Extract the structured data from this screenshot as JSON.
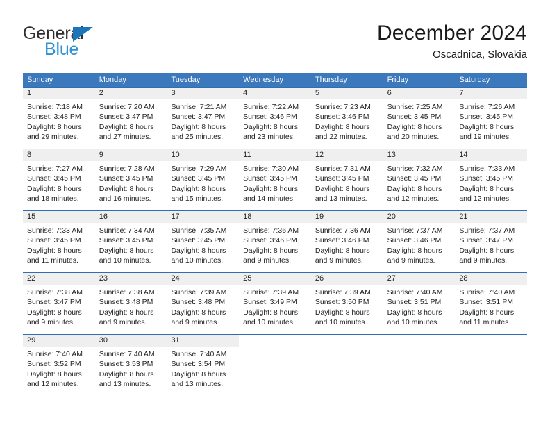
{
  "brand": {
    "name_top": "General",
    "name_bottom": "Blue",
    "triangle_color": "#1b75bb",
    "blue_text_color": "#2f92d6"
  },
  "header": {
    "title": "December 2024",
    "subtitle": "Oscadnica, Slovakia"
  },
  "theme": {
    "header_row_bg": "#3c78bc",
    "header_row_text": "#ffffff",
    "week_divider": "#2e6eb4",
    "day_number_bg": "#efefef",
    "body_text": "#231f20"
  },
  "weekdays": [
    "Sunday",
    "Monday",
    "Tuesday",
    "Wednesday",
    "Thursday",
    "Friday",
    "Saturday"
  ],
  "weeks": [
    [
      {
        "day": "1",
        "sunrise": "Sunrise: 7:18 AM",
        "sunset": "Sunset: 3:48 PM",
        "daylight_line1": "Daylight: 8 hours",
        "daylight_line2": "and 29 minutes."
      },
      {
        "day": "2",
        "sunrise": "Sunrise: 7:20 AM",
        "sunset": "Sunset: 3:47 PM",
        "daylight_line1": "Daylight: 8 hours",
        "daylight_line2": "and 27 minutes."
      },
      {
        "day": "3",
        "sunrise": "Sunrise: 7:21 AM",
        "sunset": "Sunset: 3:47 PM",
        "daylight_line1": "Daylight: 8 hours",
        "daylight_line2": "and 25 minutes."
      },
      {
        "day": "4",
        "sunrise": "Sunrise: 7:22 AM",
        "sunset": "Sunset: 3:46 PM",
        "daylight_line1": "Daylight: 8 hours",
        "daylight_line2": "and 23 minutes."
      },
      {
        "day": "5",
        "sunrise": "Sunrise: 7:23 AM",
        "sunset": "Sunset: 3:46 PM",
        "daylight_line1": "Daylight: 8 hours",
        "daylight_line2": "and 22 minutes."
      },
      {
        "day": "6",
        "sunrise": "Sunrise: 7:25 AM",
        "sunset": "Sunset: 3:45 PM",
        "daylight_line1": "Daylight: 8 hours",
        "daylight_line2": "and 20 minutes."
      },
      {
        "day": "7",
        "sunrise": "Sunrise: 7:26 AM",
        "sunset": "Sunset: 3:45 PM",
        "daylight_line1": "Daylight: 8 hours",
        "daylight_line2": "and 19 minutes."
      }
    ],
    [
      {
        "day": "8",
        "sunrise": "Sunrise: 7:27 AM",
        "sunset": "Sunset: 3:45 PM",
        "daylight_line1": "Daylight: 8 hours",
        "daylight_line2": "and 18 minutes."
      },
      {
        "day": "9",
        "sunrise": "Sunrise: 7:28 AM",
        "sunset": "Sunset: 3:45 PM",
        "daylight_line1": "Daylight: 8 hours",
        "daylight_line2": "and 16 minutes."
      },
      {
        "day": "10",
        "sunrise": "Sunrise: 7:29 AM",
        "sunset": "Sunset: 3:45 PM",
        "daylight_line1": "Daylight: 8 hours",
        "daylight_line2": "and 15 minutes."
      },
      {
        "day": "11",
        "sunrise": "Sunrise: 7:30 AM",
        "sunset": "Sunset: 3:45 PM",
        "daylight_line1": "Daylight: 8 hours",
        "daylight_line2": "and 14 minutes."
      },
      {
        "day": "12",
        "sunrise": "Sunrise: 7:31 AM",
        "sunset": "Sunset: 3:45 PM",
        "daylight_line1": "Daylight: 8 hours",
        "daylight_line2": "and 13 minutes."
      },
      {
        "day": "13",
        "sunrise": "Sunrise: 7:32 AM",
        "sunset": "Sunset: 3:45 PM",
        "daylight_line1": "Daylight: 8 hours",
        "daylight_line2": "and 12 minutes."
      },
      {
        "day": "14",
        "sunrise": "Sunrise: 7:33 AM",
        "sunset": "Sunset: 3:45 PM",
        "daylight_line1": "Daylight: 8 hours",
        "daylight_line2": "and 12 minutes."
      }
    ],
    [
      {
        "day": "15",
        "sunrise": "Sunrise: 7:33 AM",
        "sunset": "Sunset: 3:45 PM",
        "daylight_line1": "Daylight: 8 hours",
        "daylight_line2": "and 11 minutes."
      },
      {
        "day": "16",
        "sunrise": "Sunrise: 7:34 AM",
        "sunset": "Sunset: 3:45 PM",
        "daylight_line1": "Daylight: 8 hours",
        "daylight_line2": "and 10 minutes."
      },
      {
        "day": "17",
        "sunrise": "Sunrise: 7:35 AM",
        "sunset": "Sunset: 3:45 PM",
        "daylight_line1": "Daylight: 8 hours",
        "daylight_line2": "and 10 minutes."
      },
      {
        "day": "18",
        "sunrise": "Sunrise: 7:36 AM",
        "sunset": "Sunset: 3:46 PM",
        "daylight_line1": "Daylight: 8 hours",
        "daylight_line2": "and 9 minutes."
      },
      {
        "day": "19",
        "sunrise": "Sunrise: 7:36 AM",
        "sunset": "Sunset: 3:46 PM",
        "daylight_line1": "Daylight: 8 hours",
        "daylight_line2": "and 9 minutes."
      },
      {
        "day": "20",
        "sunrise": "Sunrise: 7:37 AM",
        "sunset": "Sunset: 3:46 PM",
        "daylight_line1": "Daylight: 8 hours",
        "daylight_line2": "and 9 minutes."
      },
      {
        "day": "21",
        "sunrise": "Sunrise: 7:37 AM",
        "sunset": "Sunset: 3:47 PM",
        "daylight_line1": "Daylight: 8 hours",
        "daylight_line2": "and 9 minutes."
      }
    ],
    [
      {
        "day": "22",
        "sunrise": "Sunrise: 7:38 AM",
        "sunset": "Sunset: 3:47 PM",
        "daylight_line1": "Daylight: 8 hours",
        "daylight_line2": "and 9 minutes."
      },
      {
        "day": "23",
        "sunrise": "Sunrise: 7:38 AM",
        "sunset": "Sunset: 3:48 PM",
        "daylight_line1": "Daylight: 8 hours",
        "daylight_line2": "and 9 minutes."
      },
      {
        "day": "24",
        "sunrise": "Sunrise: 7:39 AM",
        "sunset": "Sunset: 3:48 PM",
        "daylight_line1": "Daylight: 8 hours",
        "daylight_line2": "and 9 minutes."
      },
      {
        "day": "25",
        "sunrise": "Sunrise: 7:39 AM",
        "sunset": "Sunset: 3:49 PM",
        "daylight_line1": "Daylight: 8 hours",
        "daylight_line2": "and 10 minutes."
      },
      {
        "day": "26",
        "sunrise": "Sunrise: 7:39 AM",
        "sunset": "Sunset: 3:50 PM",
        "daylight_line1": "Daylight: 8 hours",
        "daylight_line2": "and 10 minutes."
      },
      {
        "day": "27",
        "sunrise": "Sunrise: 7:40 AM",
        "sunset": "Sunset: 3:51 PM",
        "daylight_line1": "Daylight: 8 hours",
        "daylight_line2": "and 10 minutes."
      },
      {
        "day": "28",
        "sunrise": "Sunrise: 7:40 AM",
        "sunset": "Sunset: 3:51 PM",
        "daylight_line1": "Daylight: 8 hours",
        "daylight_line2": "and 11 minutes."
      }
    ],
    [
      {
        "day": "29",
        "sunrise": "Sunrise: 7:40 AM",
        "sunset": "Sunset: 3:52 PM",
        "daylight_line1": "Daylight: 8 hours",
        "daylight_line2": "and 12 minutes."
      },
      {
        "day": "30",
        "sunrise": "Sunrise: 7:40 AM",
        "sunset": "Sunset: 3:53 PM",
        "daylight_line1": "Daylight: 8 hours",
        "daylight_line2": "and 13 minutes."
      },
      {
        "day": "31",
        "sunrise": "Sunrise: 7:40 AM",
        "sunset": "Sunset: 3:54 PM",
        "daylight_line1": "Daylight: 8 hours",
        "daylight_line2": "and 13 minutes."
      },
      {
        "day": "",
        "sunrise": "",
        "sunset": "",
        "daylight_line1": "",
        "daylight_line2": ""
      },
      {
        "day": "",
        "sunrise": "",
        "sunset": "",
        "daylight_line1": "",
        "daylight_line2": ""
      },
      {
        "day": "",
        "sunrise": "",
        "sunset": "",
        "daylight_line1": "",
        "daylight_line2": ""
      },
      {
        "day": "",
        "sunrise": "",
        "sunset": "",
        "daylight_line1": "",
        "daylight_line2": ""
      }
    ]
  ]
}
